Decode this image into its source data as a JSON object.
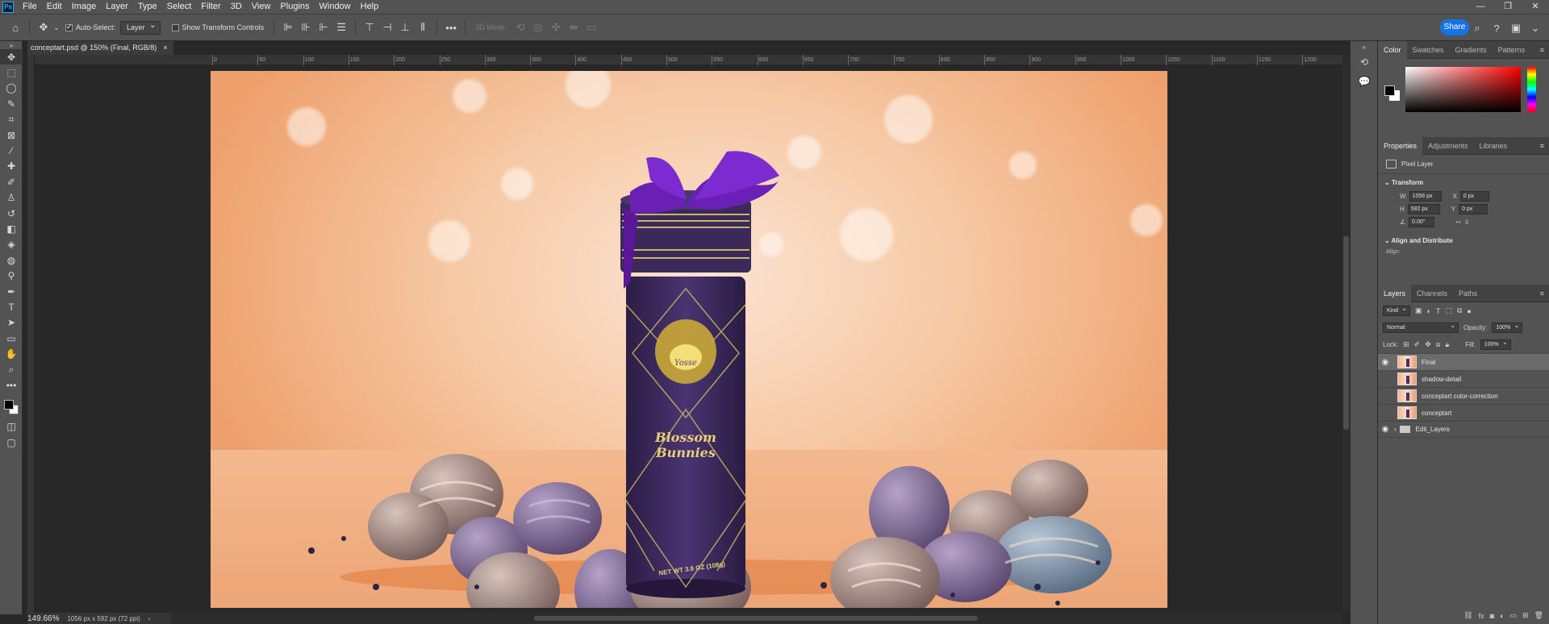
{
  "app": {
    "logo": "Ps"
  },
  "menu": [
    "File",
    "Edit",
    "Image",
    "Layer",
    "Type",
    "Select",
    "Filter",
    "3D",
    "View",
    "Plugins",
    "Window",
    "Help"
  ],
  "window_controls": [
    "—",
    "❐",
    "✕"
  ],
  "options": {
    "auto_select_label": "Auto-Select:",
    "auto_select_checked": true,
    "auto_select_target": "Layer",
    "show_transform_label": "Show Transform Controls",
    "mode_label": "3D Mode:",
    "more": "•••",
    "share_label": "Share"
  },
  "document": {
    "tab_title": "conceptart.psd @ 150% (Final, RGB/8)",
    "tab_close": "×"
  },
  "ruler_labels": [
    "0",
    "50",
    "100",
    "150",
    "200",
    "250",
    "300",
    "350",
    "400",
    "450",
    "500",
    "550",
    "600",
    "650",
    "700",
    "750",
    "800",
    "850",
    "900",
    "950",
    "1000",
    "1050",
    "1100",
    "1150",
    "1200"
  ],
  "artwork": {
    "product_name": "Blossom Bunnies",
    "net_weight": "NET WT 3.8 OZ (108g)",
    "emblem_text": "Yosse"
  },
  "status": {
    "zoom": "149.66%",
    "doc_size": "1056 px x 592 px (72 ppi)",
    "arrow": "›"
  },
  "color_panel": {
    "tabs": [
      "Color",
      "Swatches",
      "Gradients",
      "Patterns"
    ],
    "foreground": "#000000",
    "background": "#ffffff"
  },
  "properties": {
    "tabs": [
      "Properties",
      "Adjustments",
      "Libraries"
    ],
    "layer_type": "Pixel Layer",
    "transform_title": "Transform",
    "w_label": "W",
    "w_value": "1056 px",
    "h_label": "H",
    "h_value": "592 px",
    "x_label": "X",
    "x_value": "0 px",
    "y_label": "Y",
    "y_value": "0 px",
    "angle_value": "0.00°",
    "align_title": "Align and Distribute",
    "align_label": "Align:"
  },
  "layers": {
    "tabs": [
      "Layers",
      "Channels",
      "Paths"
    ],
    "filter_kind": "Kind",
    "blend_mode": "Normal",
    "opacity_label": "Opacity:",
    "opacity_value": "100%",
    "lock_label": "Lock:",
    "fill_label": "Fill:",
    "fill_value": "100%",
    "items": [
      {
        "name": "Final",
        "visible": true,
        "selected": true
      },
      {
        "name": "shadow-detail",
        "visible": false,
        "selected": false
      },
      {
        "name": "conceptart color-correction",
        "visible": false,
        "selected": false
      },
      {
        "name": "conceptart",
        "visible": false,
        "selected": false
      }
    ],
    "group": {
      "name": "Edit_Layers",
      "visible": true
    }
  },
  "colors": {
    "accent": "#1473e6",
    "ribbon": "#6a1fb5",
    "tin": "#3e2a5e",
    "gold": "#d9c46a"
  }
}
